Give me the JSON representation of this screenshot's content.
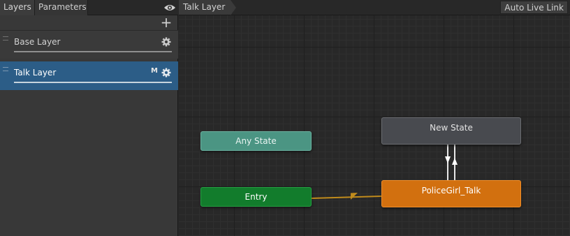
{
  "left_panel": {
    "tabs": [
      "Layers",
      "Parameters"
    ],
    "add_button": "+",
    "layers": [
      {
        "name": "Base Layer",
        "badge": ""
      },
      {
        "name": "Talk Layer",
        "badge": "M"
      }
    ]
  },
  "graph_header": {
    "breadcrumb": "Talk Layer",
    "auto_live_link": "Auto Live Link"
  },
  "graph": {
    "states": {
      "any_state": "Any State",
      "entry": "Entry",
      "new_state": "New State",
      "police": "PoliceGirl_Talk"
    },
    "transitions": [
      {
        "from": "Entry",
        "to": "PoliceGirl_Talk",
        "color": "#c08b1c"
      },
      {
        "from": "New State",
        "to": "PoliceGirl_Talk",
        "color": "#ffffff"
      },
      {
        "from": "PoliceGirl_Talk",
        "to": "New State",
        "color": "#ffffff"
      }
    ]
  },
  "colors": {
    "selected_layer": "#2c5d87",
    "any_state": "#4b9583",
    "entry": "#127c2c",
    "default_state": "#d2700f",
    "state": "#484a4f"
  },
  "icons": [
    "eye-icon",
    "gear-icon",
    "plus-icon",
    "arrow-icon"
  ]
}
